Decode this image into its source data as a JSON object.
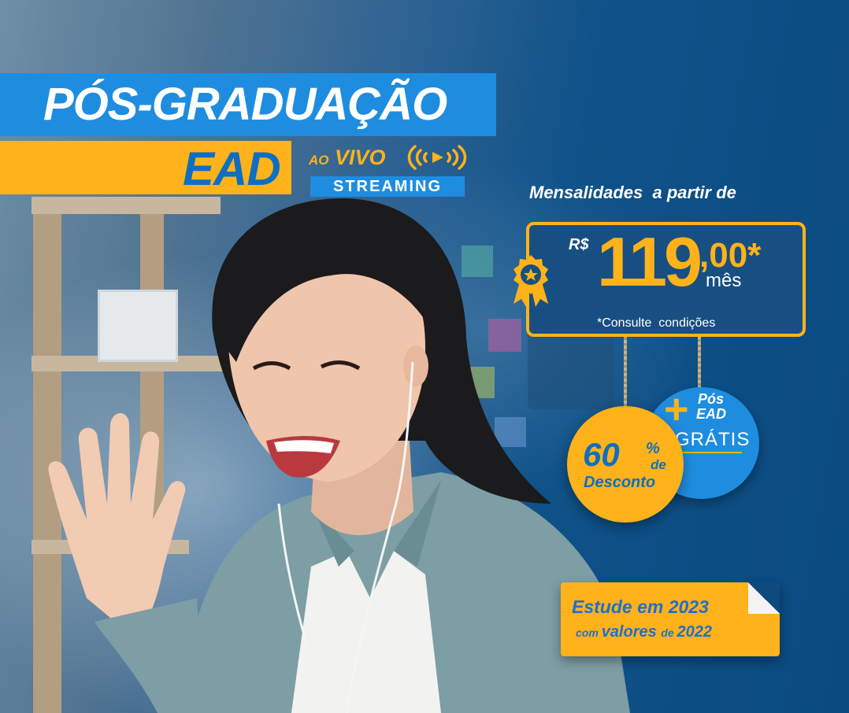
{
  "headline": {
    "title": "PÓS-GRADUAÇÃO",
    "ead": "EAD",
    "ao": "AO",
    "vivo": "VIVO",
    "streaming": "STREAMING"
  },
  "pricing": {
    "intro": "Mensalidades  a partir de",
    "currency": "R$",
    "amount": "119",
    "cents": ",00*",
    "period": "mês",
    "note": "*Consulte  condições"
  },
  "badges": {
    "discount_value": "60",
    "discount_pct": "%",
    "discount_de": "de",
    "discount_label": "Desconto",
    "plus": "+",
    "pos": "Pós",
    "ead": "EAD",
    "gratis": "GRÁTIS"
  },
  "sticker": {
    "line1": "Estude em 2023",
    "line2_a": "com ",
    "line2_b": "valores ",
    "line2_c": "de ",
    "line2_d": "2022"
  },
  "colors": {
    "blue": "#1e8de0",
    "yellow": "#ffb21a",
    "dark_blue": "#0d4f86"
  },
  "icons": {
    "live": "broadcast-waves-icon",
    "medal": "award-ribbon-icon"
  }
}
